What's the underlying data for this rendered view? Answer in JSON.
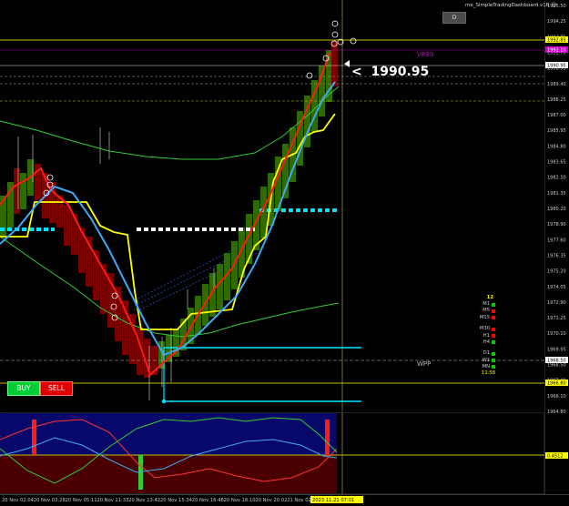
{
  "window": {
    "title": "me_SimpleTradingDashboard v1R",
    "title_icon": "smiley-icon",
    "tf_button": "D"
  },
  "current_price": {
    "marker": "<",
    "value": "1990.95"
  },
  "labels": {
    "vr": "VR30",
    "wpp": "WPP"
  },
  "buttons": {
    "buy": "BUY",
    "sell": "SELL"
  },
  "timeframes": {
    "header": "12",
    "rows": [
      {
        "name": "M1",
        "color": "#00cc00"
      },
      {
        "name": "M5",
        "color": "#ff0000"
      },
      {
        "name": "M15",
        "color": "#ff0000"
      },
      {
        "name": "",
        "color": ""
      },
      {
        "name": "M30",
        "color": "#ff0000"
      },
      {
        "name": "H1",
        "color": "#ff0000"
      },
      {
        "name": "H4",
        "color": "#00cc00"
      },
      {
        "name": "",
        "color": ""
      },
      {
        "name": "D1",
        "color": "#00cc00"
      },
      {
        "name": "W1",
        "color": "#00cc00"
      },
      {
        "name": "MN",
        "color": "#00cc00"
      }
    ],
    "footer": "11:58"
  },
  "price_axis": [
    "1995.50",
    "1994.25",
    "1992.85",
    "1991.70",
    "1990.55",
    "1989.40",
    "1988.25",
    "1987.00",
    "1985.95",
    "1984.80",
    "1983.65",
    "1982.50",
    "1981.35",
    "1980.20",
    "1978.90",
    "1977.60",
    "1976.35",
    "1975.20",
    "1974.05",
    "1972.90",
    "1971.25",
    "1970.10",
    "1969.95",
    "1968.50",
    "1967.40",
    "1966.10",
    "1964.80"
  ],
  "price_tags": {
    "top_yellow": "1992.85",
    "magenta": "1992.10",
    "current": "1990.95",
    "wpp": "1968.50",
    "bottom_yellow": "1966.80",
    "osc_level": "0.4512"
  },
  "time_axis": [
    "20 Nov 02:04",
    "20 Nov 03:28",
    "20 Nov 05:11",
    "20 Nov 11:33",
    "20 Nov 13:42",
    "20 Nov 15:34",
    "20 Nov 16:48",
    "20 Nov 18:10",
    "20 Nov 20:02",
    "21 Nov 02:29",
    "21 Nov"
  ],
  "time_tag": "2023.11.21 07:01",
  "colors": {
    "bull": "#2f6b00",
    "bear": "#7a0000",
    "accent_yellow": "#ffff00",
    "cyan": "#00e5ff",
    "red_line": "#ff1a1a",
    "blue_line": "#3fa9f5",
    "green_env": "#33cc33"
  }
}
